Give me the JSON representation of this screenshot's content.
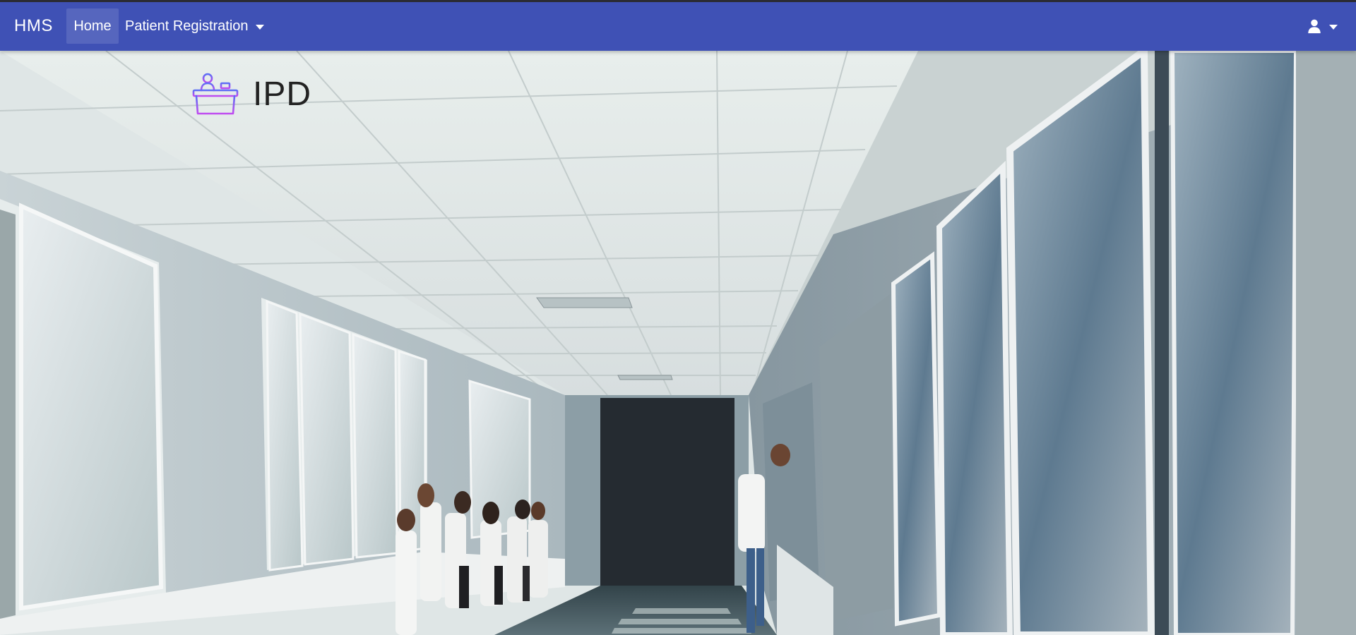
{
  "navbar": {
    "brand": "HMS",
    "items": [
      {
        "label": "Home"
      },
      {
        "label": "Patient Registration"
      }
    ],
    "user_icon": "user-icon"
  },
  "page": {
    "title": "IPD",
    "icon": "reception-desk-icon"
  },
  "colors": {
    "navbar": "#3f51b5",
    "icon_gradient_start": "#5b6ef5",
    "icon_gradient_end": "#c04cf0"
  }
}
